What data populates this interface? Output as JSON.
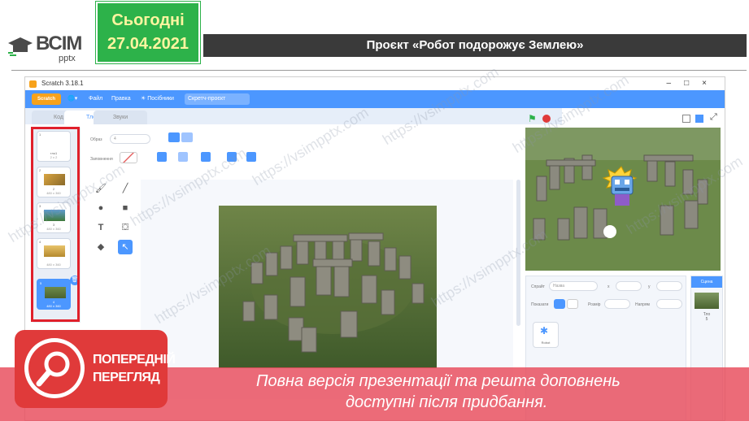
{
  "slide": {
    "logo_text": "ВСІМ",
    "logo_sub": "pptx",
    "date_label": "Сьогодні",
    "date_value": "27.04.2021",
    "title": "Проєкт «Робот подорожує Землею»"
  },
  "window": {
    "title": "Scratch 3.18.1",
    "controls": [
      "–",
      "□",
      "×"
    ]
  },
  "menubar": {
    "logo": "Scratch",
    "items": [
      "Файл",
      "Правка",
      "Посібники"
    ],
    "project_name": "Скретч-проєкт"
  },
  "tabs": [
    {
      "label": "Код"
    },
    {
      "label": "Тло"
    },
    {
      "label": "Звуки"
    }
  ],
  "editor": {
    "costume_label": "Образ",
    "costume_value": "4",
    "fill_label": "Заповнення"
  },
  "costumes": [
    {
      "num": "1",
      "name": "тло1",
      "size": "2 x 2"
    },
    {
      "num": "2",
      "name": "2",
      "size": "480 x 360"
    },
    {
      "num": "3",
      "name": "3",
      "size": "480 x 360"
    },
    {
      "num": "4",
      "name": "",
      "size": "480 x 360"
    },
    {
      "num": "5",
      "name": "4",
      "size": "480 x 360"
    }
  ],
  "sprite_panel": {
    "sprite_label": "Спрайт",
    "sprite_value": "Назва",
    "x_label": "x",
    "y_label": "y",
    "show_label": "Показати",
    "size_label": "Розмір",
    "direction_label": "Напрям",
    "sprite_name": "Robot"
  },
  "stage_panel": {
    "header": "Сцена",
    "backdrops_label": "Тло",
    "backdrops_count": "5"
  },
  "overlay": {
    "badge_line1": "ПОПЕРЕДНІЙ",
    "badge_line2": "ПЕРЕГЛЯД",
    "message_line1": "Повна версія презентації та решта доповнень",
    "message_line2": "доступні після придбання."
  },
  "watermark": "https://vsimpptx.com",
  "colors": {
    "scratch_blue": "#4c97ff",
    "date_green": "#2db24a",
    "overlay_red": "#e84a5a",
    "frame_red": "#e0202b"
  }
}
